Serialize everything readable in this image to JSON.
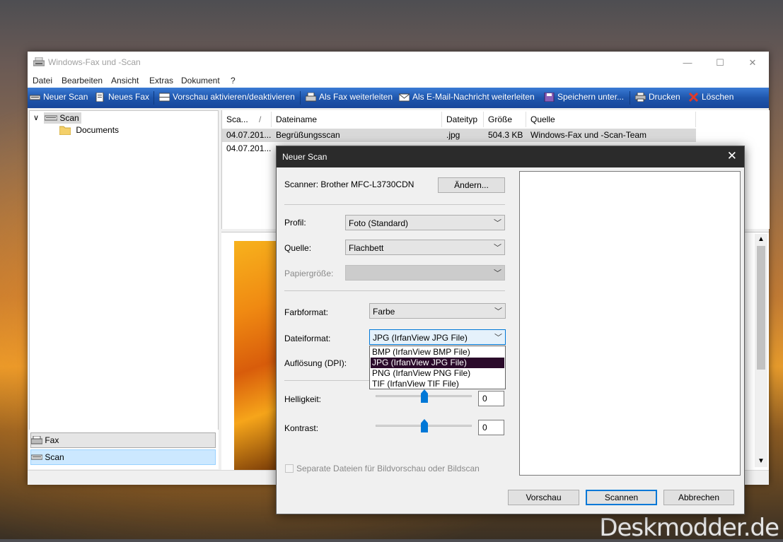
{
  "window": {
    "title": "Windows-Fax und -Scan",
    "controls": {
      "minimize": "—",
      "maximize": "☐",
      "close": "✕"
    }
  },
  "menu": [
    "Datei",
    "Bearbeiten",
    "Ansicht",
    "Extras",
    "Dokument",
    "?"
  ],
  "toolbar": {
    "new_scan": "Neuer Scan",
    "new_fax": "Neues Fax",
    "preview_toggle": "Vorschau aktivieren/deaktivieren",
    "forward_fax": "Als Fax weiterleiten",
    "forward_email": "Als E-Mail-Nachricht weiterleiten",
    "save_as": "Speichern unter...",
    "print": "Drucken",
    "delete": "Löschen"
  },
  "tree": {
    "root": "Scan",
    "child": "Documents",
    "expander": "∨"
  },
  "nav": {
    "fax": "Fax",
    "scan": "Scan"
  },
  "list": {
    "columns": [
      "Sca...",
      "Dateiname",
      "Dateityp",
      "Größe",
      "Quelle"
    ],
    "sort_indicator": "/",
    "rows": [
      {
        "date": "04.07.201...",
        "name": "Begrüßungsscan",
        "type": ".jpg",
        "size": "504.3 KB",
        "source": "Windows-Fax und -Scan-Team"
      },
      {
        "date": "04.07.201...",
        "name": "",
        "type": "",
        "size": "",
        "source": ""
      }
    ]
  },
  "dialog": {
    "title": "Neuer Scan",
    "close": "✕",
    "scanner_label": "Scanner: Brother MFC-L3730CDN",
    "change_button": "Ändern...",
    "profile_label": "Profil:",
    "profile_value": "Foto (Standard)",
    "source_label": "Quelle:",
    "source_value": "Flachbett",
    "paper_label": "Papiergröße:",
    "paper_value": "",
    "color_label": "Farbformat:",
    "color_value": "Farbe",
    "filetype_label": "Dateiformat:",
    "filetype_value": "JPG (IrfanView JPG File)",
    "filetype_options": [
      "BMP (IrfanView BMP File)",
      "JPG (IrfanView JPG File)",
      "PNG (IrfanView PNG File)",
      "TIF (IrfanView TIF File)"
    ],
    "filetype_selected_index": 1,
    "resolution_label": "Auflösung (DPI):",
    "brightness_label": "Helligkeit:",
    "brightness_value": "0",
    "contrast_label": "Kontrast:",
    "contrast_value": "0",
    "separate_checkbox": "Separate Dateien für Bildvorschau oder Bildscan",
    "separate_checked": false,
    "preview_button": "Vorschau",
    "scan_button": "Scannen",
    "cancel_button": "Abbrechen"
  },
  "watermark": "Deskmodder.de",
  "colors": {
    "toolbar": "#1f56ac",
    "accent": "#0078d7",
    "dialog_title": "#2b2b2b",
    "selected_option": "#2a0a2a"
  }
}
